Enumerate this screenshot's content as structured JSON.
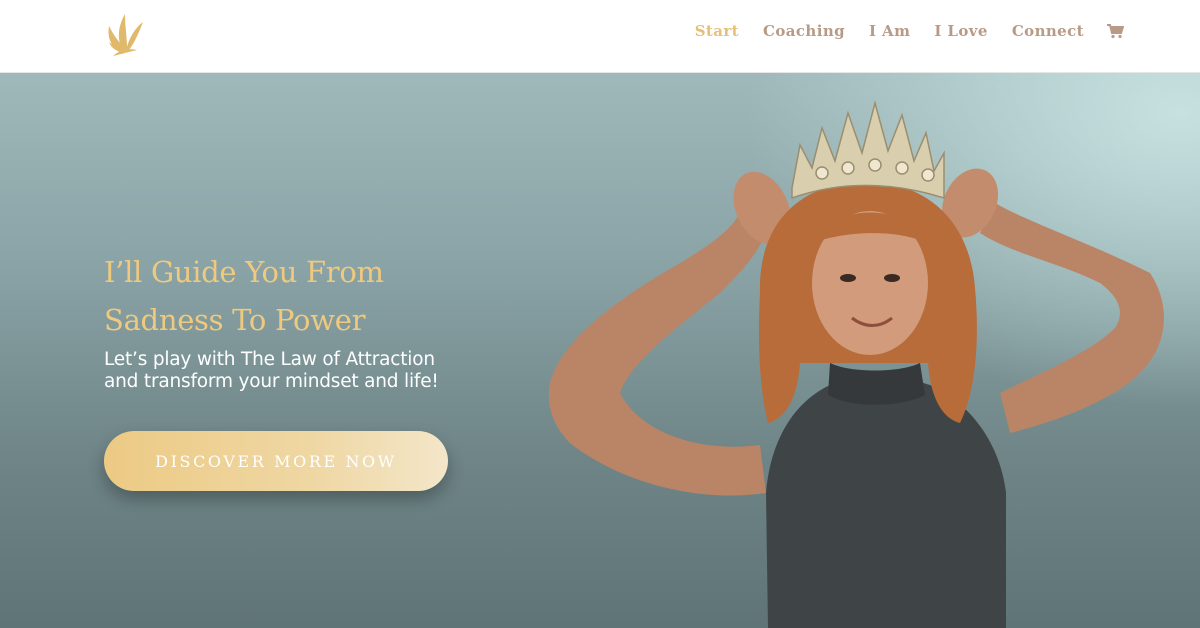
{
  "header": {
    "logo_icon": "feather-wing-logo",
    "nav": [
      {
        "label": "Start",
        "active": true
      },
      {
        "label": "Coaching",
        "active": false
      },
      {
        "label": "I Am",
        "active": false
      },
      {
        "label": "I Love",
        "active": false
      },
      {
        "label": "Connect",
        "active": false
      }
    ],
    "cart_icon": "shopping-cart-icon"
  },
  "hero": {
    "headline_line1": "I’ll Guide You From",
    "headline_line2": "Sadness To Power",
    "subline_line1": "Let’s play with The Law of Attraction",
    "subline_line2": "and transform your mindset and life!",
    "cta_label": "DISCOVER MORE NOW",
    "image": "woman-wearing-crown-photo"
  },
  "colors": {
    "accent_gold": "#efc97d",
    "nav_text": "#b79b86",
    "nav_active": "#e6c078",
    "hero_bg": "#7f989a"
  }
}
